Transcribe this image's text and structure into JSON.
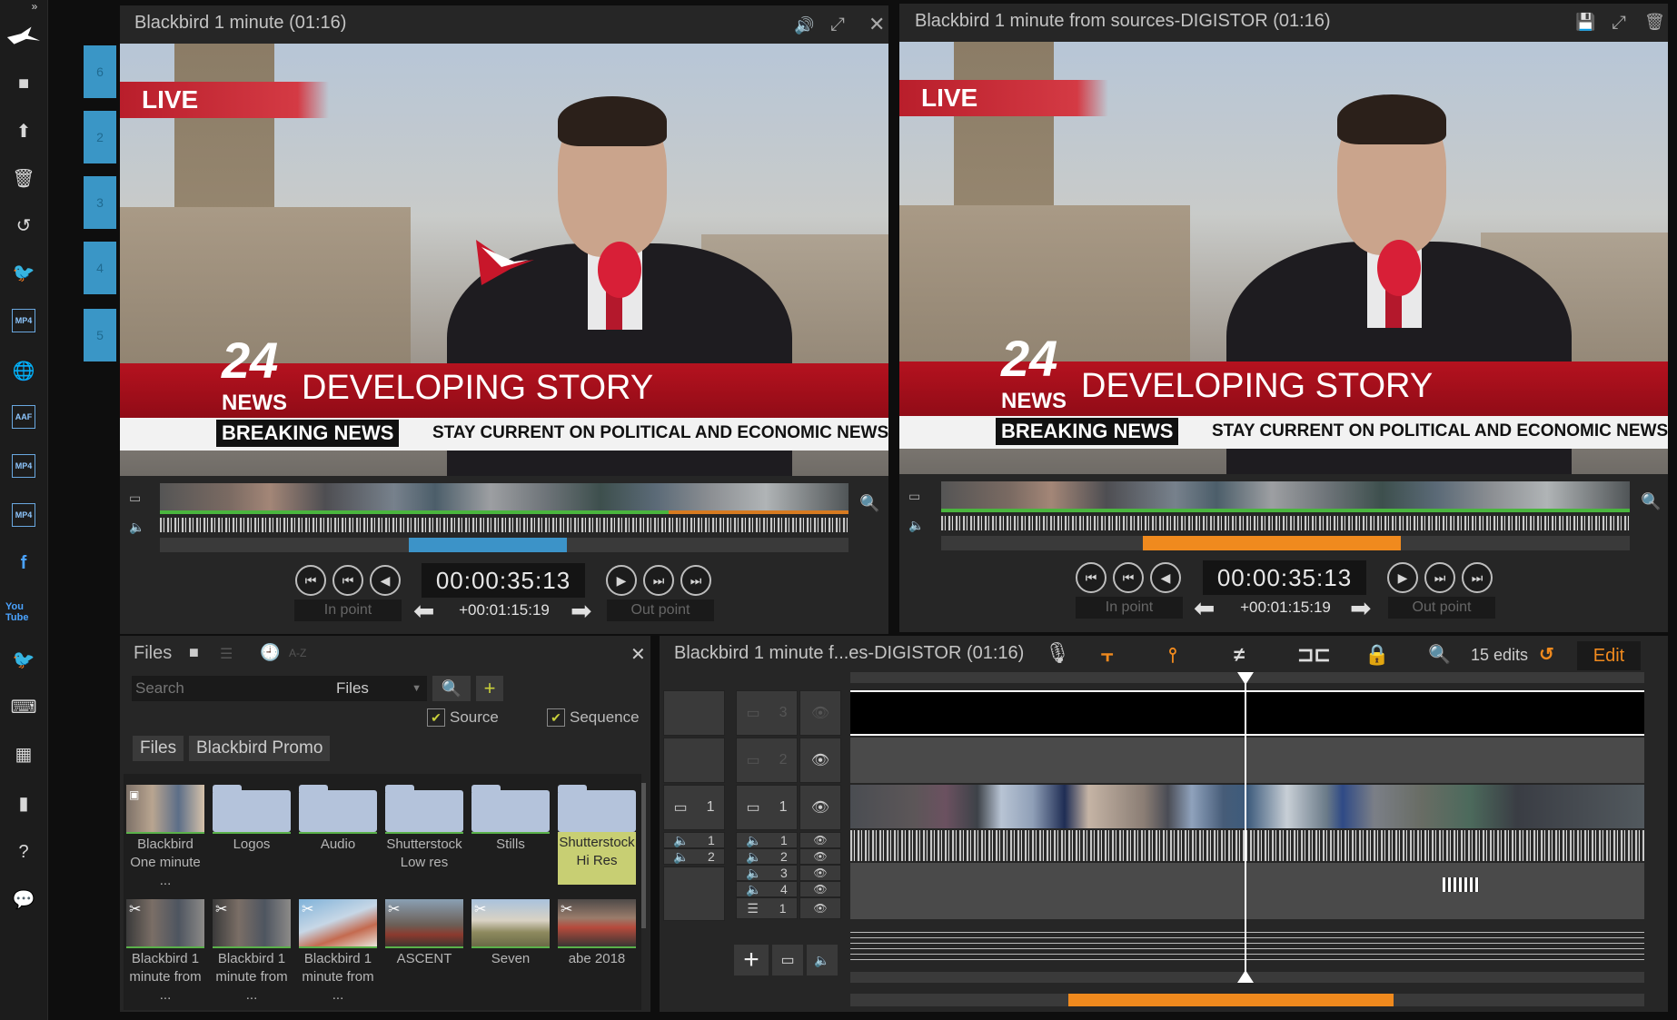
{
  "sidebar": {
    "icons": [
      "arrows-icon",
      "blackbird-logo",
      "folder-icon",
      "upload-icon",
      "trash-icon",
      "history-icon",
      "twitter-icon",
      "mp4-icon",
      "globe-icon",
      "aaf-icon",
      "mp4-icon",
      "mp4-icon",
      "facebook-icon",
      "youtube-icon",
      "twitter-icon",
      "keyboard-icon",
      "film-icon",
      "chart-icon",
      "help-icon",
      "chat-icon"
    ],
    "mp4_label": "MP4",
    "aaf_label": "AAF",
    "youtube_label": "You Tube"
  },
  "left_tabs": [
    "6",
    "2",
    "3",
    "4",
    "5"
  ],
  "source_viewer": {
    "title": "Blackbird 1 minute (01:16)",
    "timecode": "00:00:35:13",
    "duration": "+00:01:15:19",
    "in_point": "In point",
    "out_point": "Out point"
  },
  "program_viewer": {
    "title": "Blackbird 1 minute from sources-DIGISTOR (01:16)",
    "timecode": "00:00:35:13",
    "duration": "+00:01:15:19",
    "in_point": "In point",
    "out_point": "Out point"
  },
  "video_overlay": {
    "live": "LIVE",
    "num": "24",
    "news": "NEWS",
    "story": "DEVELOPING STORY",
    "breaking": "BREAKING NEWS",
    "ticker": "STAY CURRENT ON POLITICAL AND ECONOMIC NEWS"
  },
  "files_panel": {
    "title": "Files",
    "sort_label": "A-Z",
    "search_placeholder": "Search",
    "dropdown_value": "Files",
    "source_label": "Source",
    "sequence_label": "Sequence",
    "breadcrumb": [
      "Files",
      "Blackbird Promo"
    ],
    "items": [
      {
        "label": "Blackbird One minute ...",
        "kind": "video"
      },
      {
        "label": "Logos",
        "kind": "folder"
      },
      {
        "label": "Audio",
        "kind": "folder"
      },
      {
        "label": "Shutterstock Low res",
        "kind": "folder"
      },
      {
        "label": "Stills",
        "kind": "folder"
      },
      {
        "label": "Shutterstock Hi Res",
        "kind": "folder-selected"
      },
      {
        "label": "Blackbird 1 minute from ...",
        "kind": "clip"
      },
      {
        "label": "Blackbird 1 minute from ...",
        "kind": "clip"
      },
      {
        "label": "Blackbird 1 minute from ...",
        "kind": "clip"
      },
      {
        "label": "ASCENT",
        "kind": "clip"
      },
      {
        "label": "Seven",
        "kind": "clip"
      },
      {
        "label": "abe 2018",
        "kind": "clip"
      }
    ]
  },
  "timeline": {
    "title": "Blackbird 1 minute f...es-DIGISTOR (01:16)",
    "edits": "15 edits",
    "edit_button": "Edit",
    "tracks": {
      "video_rows": [
        "3",
        "2",
        "1"
      ],
      "audio_rows": [
        "1",
        "2",
        "3",
        "4"
      ],
      "sub_row": "1",
      "left_video": "1",
      "left_audio": [
        "1",
        "2"
      ]
    }
  },
  "colors": {
    "accent_orange": "#f08a1e",
    "accent_blue": "#3a96c6",
    "folder": "#b4c3db",
    "selected_folder": "#c8cf73"
  }
}
